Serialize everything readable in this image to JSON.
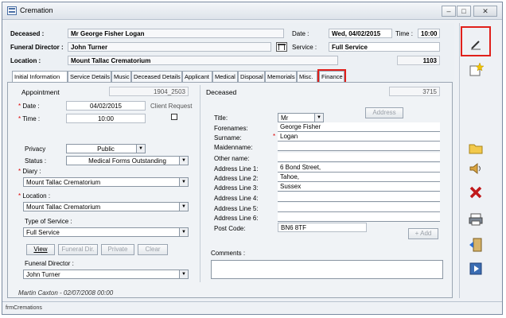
{
  "window": {
    "title": "Cremation",
    "status": "frmCremations"
  },
  "header": {
    "deceased_label": "Deceased :",
    "deceased_value": "Mr George Fisher Logan",
    "date_label": "Date :",
    "date_value": "Wed, 04/02/2015",
    "time_label": "Time :",
    "time_value": "10:00",
    "fd_label": "Funeral Director :",
    "fd_value": "John Turner",
    "service_label": "Service :",
    "service_value": "Full Service",
    "location_label": "Location :",
    "location_value": "Mount Tallac Crematorium",
    "number": "1103"
  },
  "tabs": [
    "Initial Information",
    "Service Details",
    "Music",
    "Deceased Details",
    "Applicant",
    "Medical",
    "Disposal",
    "Memorials",
    "Misc.",
    "Finance"
  ],
  "left": {
    "appointment_label": "Appointment",
    "appointment_value": "1904_2503",
    "date_label": "Date :",
    "date_value": "04/02/2015",
    "client_request": "Client Request",
    "time_label": "Time :",
    "time_value": "10:00",
    "privacy_label": "Privacy",
    "privacy_value": "Public",
    "status_label": "Status :",
    "status_value": "Medical Forms Outstanding",
    "diary_label": "Diary :",
    "diary_value": "Mount Tallac Crematorium",
    "location_label": "Location :",
    "location_value": "Mount Tallac Crematorium",
    "type_label": "Type of Service :",
    "type_value": "Full Service",
    "btn_view": "View",
    "btn_funeral": "Funeral Dir.",
    "btn_private": "Private",
    "btn_clear": "Clear",
    "fd_label": "Funeral Director :",
    "fd_value": "John Turner",
    "footer": "Martin Caxton - 02/07/2008 00:00"
  },
  "right": {
    "deceased_label": "Deceased",
    "deceased_id": "3715",
    "title_label": "Title:",
    "title_value": "Mr",
    "address_btn": "Address",
    "forenames_label": "Forenames:",
    "forenames_value": "George Fisher",
    "surname_label": "Surname:",
    "surname_value": "Logan",
    "maiden_label": "Maidenname:",
    "other_label": "Other name:",
    "addr1_label": "Address Line 1:",
    "addr1_value": "6 Bond Street,",
    "addr2_label": "Address Line 2:",
    "addr2_value": "Tahoe,",
    "addr3_label": "Address Line 3:",
    "addr3_value": "Sussex",
    "addr4_label": "Address Line 4:",
    "addr5_label": "Address Line 5:",
    "addr6_label": "Address Line 6:",
    "post_label": "Post Code:",
    "post_value": "BN6 8TF",
    "add_btn": "+ Add",
    "comments_label": "Comments :"
  },
  "colors": {
    "highlight": "#e0201b",
    "required": "#dd0000"
  }
}
